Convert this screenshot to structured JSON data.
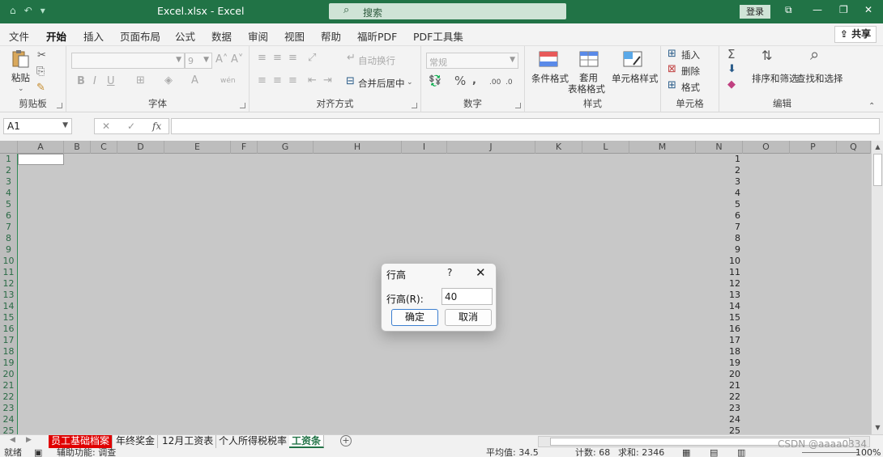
{
  "titlebar": {
    "doc_title": "Excel.xlsx  -  Excel",
    "search_placeholder": "搜索",
    "signin_label": "登录",
    "minimize_icon": "—",
    "restore_icon": "❐",
    "close_icon": "✕",
    "ribbon_display_icon": "⧉"
  },
  "tabs": [
    "文件",
    "开始",
    "插入",
    "页面布局",
    "公式",
    "数据",
    "审阅",
    "视图",
    "帮助",
    "福昕PDF",
    "PDF工具集"
  ],
  "share_label": "共享",
  "ribbon": {
    "clipboard": {
      "label": "剪贴板",
      "paste": "粘贴"
    },
    "font": {
      "label": "字体",
      "font_name": "",
      "font_size": "9"
    },
    "alignment": {
      "label": "对齐方式",
      "wrap_text": "自动换行",
      "merge_center": "合并后居中"
    },
    "number": {
      "label": "数字",
      "format": "常规"
    },
    "styles": {
      "label": "样式",
      "conditional": "条件格式",
      "table_fmt_1": "套用",
      "table_fmt_2": "表格格式",
      "cell_styles": "单元格样式"
    },
    "cells": {
      "label": "单元格",
      "insert": "插入",
      "delete": "删除",
      "format": "格式"
    },
    "editing": {
      "label": "编辑",
      "sort_filter": "排序和筛选",
      "find_select": "查找和选择"
    }
  },
  "formula_bar": {
    "name_box": "A1",
    "fx_label": "fx",
    "content": ""
  },
  "columns": [
    "A",
    "B",
    "C",
    "D",
    "E",
    "F",
    "G",
    "H",
    "I",
    "J",
    "K",
    "L",
    "M",
    "N",
    "O",
    "P",
    "Q"
  ],
  "rows": [
    "1",
    "2",
    "3",
    "4",
    "5",
    "6",
    "7",
    "8",
    "9",
    "10",
    "11",
    "12",
    "13",
    "14",
    "15",
    "16",
    "17",
    "18",
    "19",
    "20",
    "21",
    "22",
    "23",
    "24",
    "25"
  ],
  "column_n_values": [
    "1",
    "2",
    "3",
    "4",
    "5",
    "6",
    "7",
    "8",
    "9",
    "10",
    "11",
    "12",
    "13",
    "14",
    "15",
    "16",
    "17",
    "18",
    "19",
    "20",
    "21",
    "22",
    "23",
    "24",
    "25"
  ],
  "dialog": {
    "title": "行高",
    "help": "?",
    "close": "✕",
    "field_label": "行高(R):",
    "field_value": "40",
    "ok": "确定",
    "cancel": "取消"
  },
  "sheets": [
    "员工基础档案",
    "年终奖金",
    "12月工资表",
    "个人所得税税率",
    "工资条"
  ],
  "active_sheet": "工资条",
  "status": {
    "ready": "就绪",
    "accessibility": "辅助功能: 调查",
    "average": "平均值: 34.5",
    "count": "计数: 68",
    "sum": "求和: 2346",
    "zoom": "100%"
  },
  "watermark": "CSDN @aaaa0334",
  "colors": {
    "excel_green": "#217346",
    "red_tab": "#e00000"
  }
}
